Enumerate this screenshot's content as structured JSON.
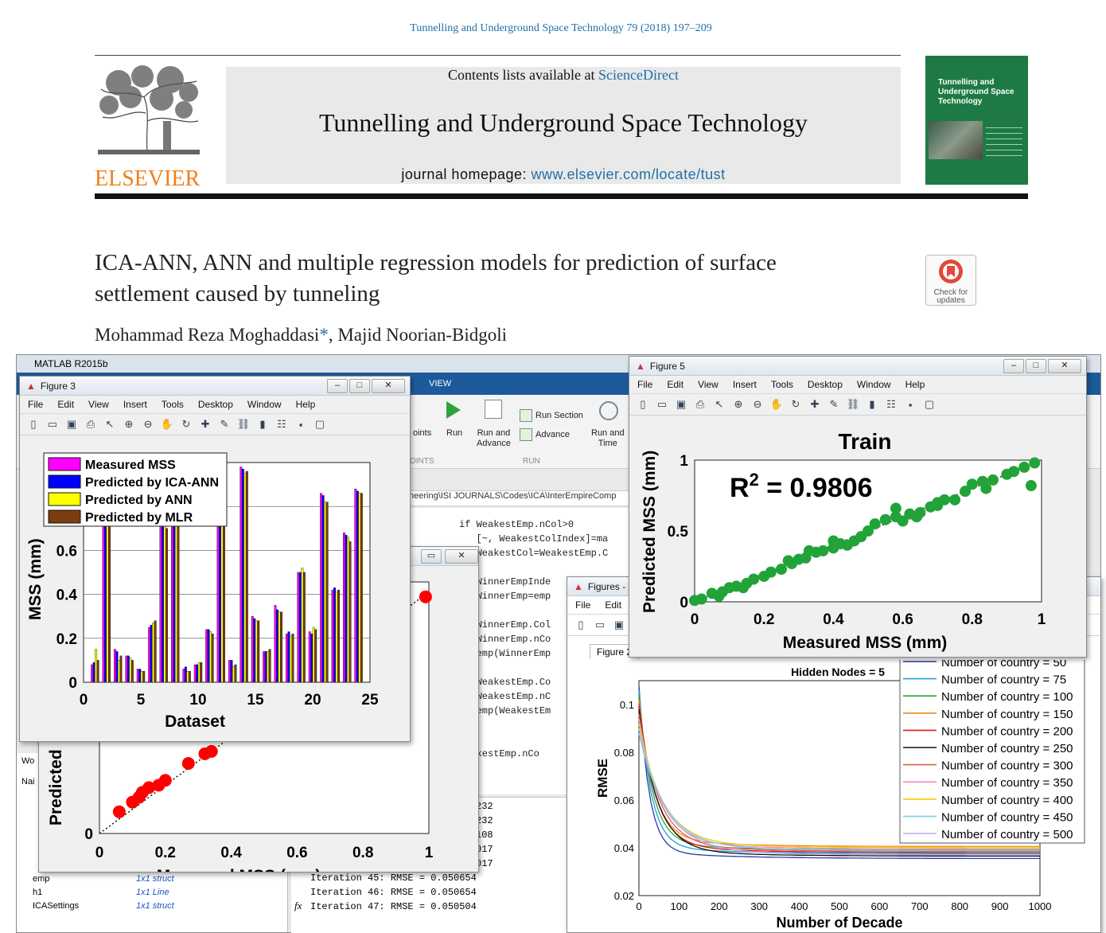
{
  "header": {
    "citation": "Tunnelling and Underground Space Technology 79 (2018) 197–209",
    "contents_prefix": "Contents lists available at ",
    "contents_link": "ScienceDirect",
    "journal_title": "Tunnelling and Underground Space Technology",
    "homepage_prefix": "journal homepage: ",
    "homepage_link": "www.elsevier.com/locate/tust",
    "publisher": "ELSEVIER",
    "cover_title": "Tunnelling and Underground Space Technology",
    "check_updates": "Check for updates"
  },
  "article": {
    "title_line1": "ICA-ANN, ANN and multiple regression models for prediction of surface",
    "title_line2": "settlement caused by tunneling",
    "authors_a": "Mohammad Reza Moghaddasi",
    "authors_star": "*",
    "authors_b": ", Majid Noorian-Bidgoli"
  },
  "matlab": {
    "title": "MATLAB R2015b",
    "tab_view": "VIEW",
    "run_label": "Run",
    "run_advance": "Run and\nAdvance",
    "run_section": "Run Section",
    "advance": "Advance",
    "run_time": "Run and\nTime",
    "run_group": "RUN",
    "oints_partial": "oints",
    "oints_group": "OINTS",
    "path": "neering\\ISI JOURNALS\\Codes\\ICA\\InterEmpireComp",
    "code": [
      "if WeakestEmp.nCol>0",
      "   [~, WeakestColIndex]=ma",
      "   WeakestCol=WeakestEmp.C",
      "",
      "   WinnerEmpInde",
      "   WinnerEmp=emp",
      "",
      "   WinnerEmp.Col",
      "   WinnerEmp.nCo",
      "   emp(WinnerEmp",
      "",
      "   WeakestEmp.Co",
      "   WeakestEmp.nC",
      "   emp(WeakestEm",
      "",
      "",
      "WeakestEmp.nCo"
    ],
    "iter_partial": [
      "232",
      "232",
      "108",
      "017",
      "017"
    ],
    "iterations": [
      "Iteration 45: RMSE = 0.050654",
      "Iteration 46: RMSE = 0.050654",
      "Iteration 47: RMSE = 0.050504"
    ],
    "workspace": [
      {
        "name": "emp",
        "value": "1x1 struct"
      },
      {
        "name": "h1",
        "value": "1x1 Line"
      },
      {
        "name": "ICASettings",
        "value": "1x1 struct"
      }
    ],
    "wo": "Wo",
    "na": "Nai",
    "fx": "fx"
  },
  "menus": {
    "figure": [
      "File",
      "Edit",
      "View",
      "Insert",
      "Tools",
      "Desktop",
      "Window",
      "Help"
    ],
    "figures_small": [
      "File",
      "Edit"
    ]
  },
  "figure3": {
    "title": "Figure 3",
    "chart_data": {
      "type": "bar",
      "xlabel": "Dataset",
      "ylabel": "MSS (mm)",
      "xticks": [
        "0",
        "5",
        "10",
        "15",
        "20",
        "25"
      ],
      "yticks": [
        "0",
        "0.2",
        "0.4",
        "0.6"
      ],
      "ylim": [
        0,
        1
      ],
      "legend_placement": "top-left",
      "series": [
        {
          "name": "Measured MSS",
          "color": "#ff00ff",
          "values": [
            0.08,
            0.83,
            0.15,
            0.12,
            0.06,
            0.25,
            0.75,
            0.8,
            0.06,
            0.08,
            0.24,
            0.81,
            0.1,
            0.98,
            0.3,
            0.14,
            0.35,
            0.22,
            0.5,
            0.23,
            0.86,
            0.42,
            0.68,
            0.88
          ]
        },
        {
          "name": "Predicted by ICA-ANN",
          "color": "#0000ff",
          "values": [
            0.09,
            0.84,
            0.14,
            0.12,
            0.06,
            0.26,
            0.74,
            0.81,
            0.07,
            0.08,
            0.24,
            0.8,
            0.1,
            0.97,
            0.29,
            0.14,
            0.33,
            0.23,
            0.5,
            0.22,
            0.85,
            0.43,
            0.67,
            0.87
          ]
        },
        {
          "name": "Predicted by ANN",
          "color": "#ffff00",
          "values": [
            0.15,
            0.85,
            0.1,
            0.11,
            0.05,
            0.27,
            0.72,
            0.78,
            0.05,
            0.09,
            0.23,
            0.79,
            0.07,
            0.95,
            0.28,
            0.14,
            0.32,
            0.21,
            0.52,
            0.25,
            0.82,
            0.41,
            0.66,
            0.86
          ]
        },
        {
          "name": "Predicted by MLR",
          "color": "#7a3e10",
          "values": [
            0.1,
            0.84,
            0.12,
            0.1,
            0.05,
            0.28,
            0.7,
            0.8,
            0.05,
            0.09,
            0.22,
            0.8,
            0.08,
            0.96,
            0.28,
            0.15,
            0.32,
            0.22,
            0.5,
            0.24,
            0.82,
            0.42,
            0.64,
            0.86
          ]
        }
      ]
    }
  },
  "figure5": {
    "title": "Figure 5",
    "chart_data": {
      "type": "scatter",
      "title": "Train",
      "annotation": "R",
      "annotation_sup": "2",
      "annotation_rest": " = 0.9806",
      "xlabel": "Measured MSS (mm)",
      "ylabel": "Predicted MSS (mm)",
      "xlim": [
        0,
        1
      ],
      "ylim": [
        0,
        1
      ],
      "xticks": [
        "0",
        "0.2",
        "0.4",
        "0.6",
        "0.8",
        "1"
      ],
      "yticks": [
        "0",
        "0.5",
        "1"
      ],
      "color": "#22a33a",
      "points": [
        [
          0.0,
          0.01
        ],
        [
          0.02,
          0.02
        ],
        [
          0.05,
          0.06
        ],
        [
          0.08,
          0.07
        ],
        [
          0.1,
          0.1
        ],
        [
          0.12,
          0.11
        ],
        [
          0.15,
          0.13
        ],
        [
          0.17,
          0.16
        ],
        [
          0.2,
          0.18
        ],
        [
          0.22,
          0.21
        ],
        [
          0.25,
          0.23
        ],
        [
          0.28,
          0.27
        ],
        [
          0.3,
          0.3
        ],
        [
          0.32,
          0.31
        ],
        [
          0.35,
          0.35
        ],
        [
          0.37,
          0.36
        ],
        [
          0.4,
          0.38
        ],
        [
          0.42,
          0.41
        ],
        [
          0.44,
          0.4
        ],
        [
          0.46,
          0.43
        ],
        [
          0.48,
          0.46
        ],
        [
          0.5,
          0.5
        ],
        [
          0.52,
          0.55
        ],
        [
          0.55,
          0.58
        ],
        [
          0.58,
          0.6
        ],
        [
          0.6,
          0.57
        ],
        [
          0.62,
          0.62
        ],
        [
          0.65,
          0.63
        ],
        [
          0.68,
          0.67
        ],
        [
          0.7,
          0.7
        ],
        [
          0.72,
          0.72
        ],
        [
          0.75,
          0.72
        ],
        [
          0.78,
          0.78
        ],
        [
          0.8,
          0.83
        ],
        [
          0.83,
          0.85
        ],
        [
          0.86,
          0.86
        ],
        [
          0.9,
          0.9
        ],
        [
          0.92,
          0.92
        ],
        [
          0.95,
          0.95
        ],
        [
          0.98,
          0.98
        ],
        [
          0.97,
          0.82
        ],
        [
          0.84,
          0.8
        ],
        [
          0.64,
          0.6
        ],
        [
          0.27,
          0.29
        ],
        [
          0.33,
          0.36
        ],
        [
          0.58,
          0.66
        ],
        [
          0.07,
          0.04
        ],
        [
          0.14,
          0.1
        ],
        [
          0.4,
          0.43
        ],
        [
          0.7,
          0.68
        ]
      ]
    }
  },
  "figure_left": {
    "chart_data": {
      "type": "scatter",
      "xlabel": "Measured MSS (mm)",
      "ylabel_partial": "Predicted",
      "xlim": [
        0,
        1
      ],
      "xticks": [
        "0",
        "0.2",
        "0.4",
        "0.6",
        "0.8",
        "1"
      ],
      "yticks": [
        "0"
      ],
      "color": "#ff0000",
      "points": [
        [
          0.06,
          0.09
        ],
        [
          0.1,
          0.13
        ],
        [
          0.12,
          0.15
        ],
        [
          0.13,
          0.17
        ],
        [
          0.15,
          0.19
        ],
        [
          0.18,
          0.2
        ],
        [
          0.2,
          0.22
        ],
        [
          0.27,
          0.29
        ],
        [
          0.32,
          0.33
        ],
        [
          0.34,
          0.34
        ],
        [
          0.4,
          0.42
        ],
        [
          0.45,
          0.5
        ],
        [
          0.99,
          0.98
        ]
      ]
    }
  },
  "figures_window": {
    "title": "Figures -",
    "tab": "Figure 2",
    "chart_data": {
      "type": "line",
      "title": "Hidden Nodes = 5",
      "xlabel": "Number of Decade",
      "ylabel": "RMSE",
      "xlim": [
        0,
        1000
      ],
      "ylim": [
        0.02,
        0.11
      ],
      "xticks": [
        "0",
        "100",
        "200",
        "300",
        "400",
        "500",
        "600",
        "700",
        "800",
        "900",
        "1000"
      ],
      "yticks": [
        "0.02",
        "0.04",
        "0.06",
        "0.08",
        "0.1"
      ],
      "legend_placement": "top-right",
      "series": [
        {
          "name": "Number of country = 50",
          "color": "#2a3aa8",
          "final": 0.0355
        },
        {
          "name": "Number of country = 75",
          "color": "#1ea0dd",
          "final": 0.0375
        },
        {
          "name": "Number of country = 100",
          "color": "#2ea43a",
          "final": 0.039
        },
        {
          "name": "Number of country = 150",
          "color": "#f08a1c",
          "final": 0.0405
        },
        {
          "name": "Number of country = 200",
          "color": "#e01e1e",
          "final": 0.038
        },
        {
          "name": "Number of country = 250",
          "color": "#111111",
          "final": 0.0365
        },
        {
          "name": "Number of country = 300",
          "color": "#e0604a",
          "final": 0.0385
        },
        {
          "name": "Number of country = 350",
          "color": "#f08ad2",
          "final": 0.0395
        },
        {
          "name": "Number of country = 400",
          "color": "#f0cc10",
          "final": 0.04
        },
        {
          "name": "Number of country = 450",
          "color": "#7ad0ea",
          "final": 0.0388
        },
        {
          "name": "Number of country = 500",
          "color": "#b8a8e8",
          "final": 0.037
        }
      ]
    }
  }
}
